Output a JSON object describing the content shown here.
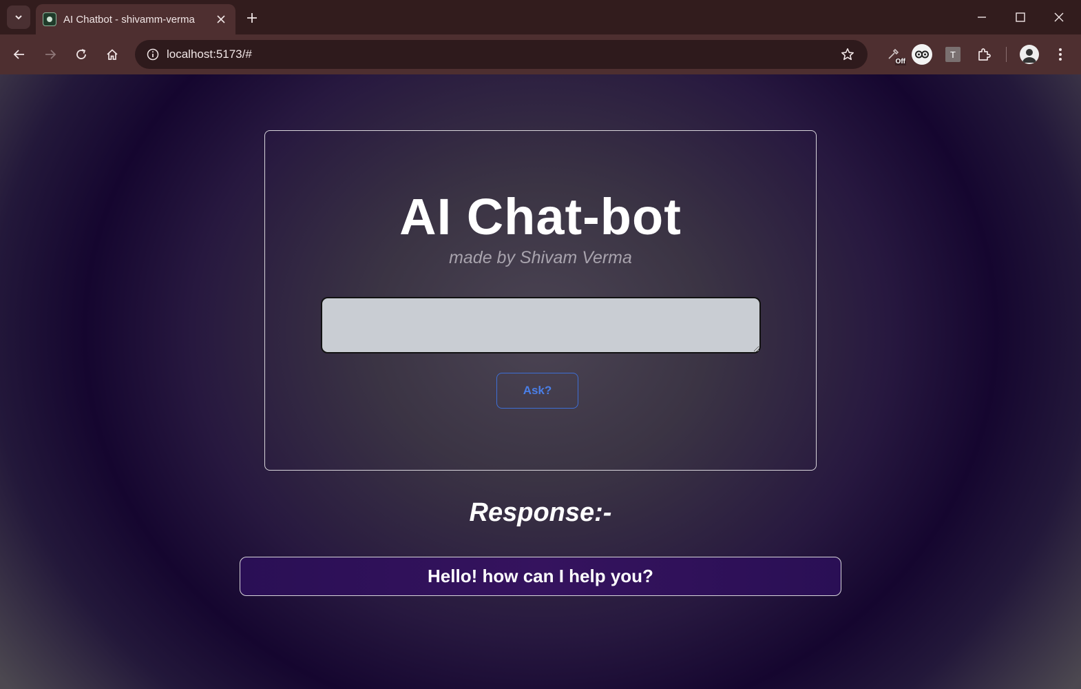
{
  "browser": {
    "tab_title": "AI Chatbot - shivamm-verma",
    "url": "localhost:5173/#",
    "extension_badge": "Off",
    "extension_t_label": "T"
  },
  "app": {
    "title": "AI Chat-bot",
    "subtitle": "made by Shivam Verma",
    "prompt_value": "",
    "ask_label": "Ask?",
    "response_label": "Response:-",
    "response_text": "Hello! how can I help you?"
  },
  "colors": {
    "accent_blue": "#4a7fe8",
    "response_bg": "#2a0f55",
    "page_dark": "#15062f"
  }
}
